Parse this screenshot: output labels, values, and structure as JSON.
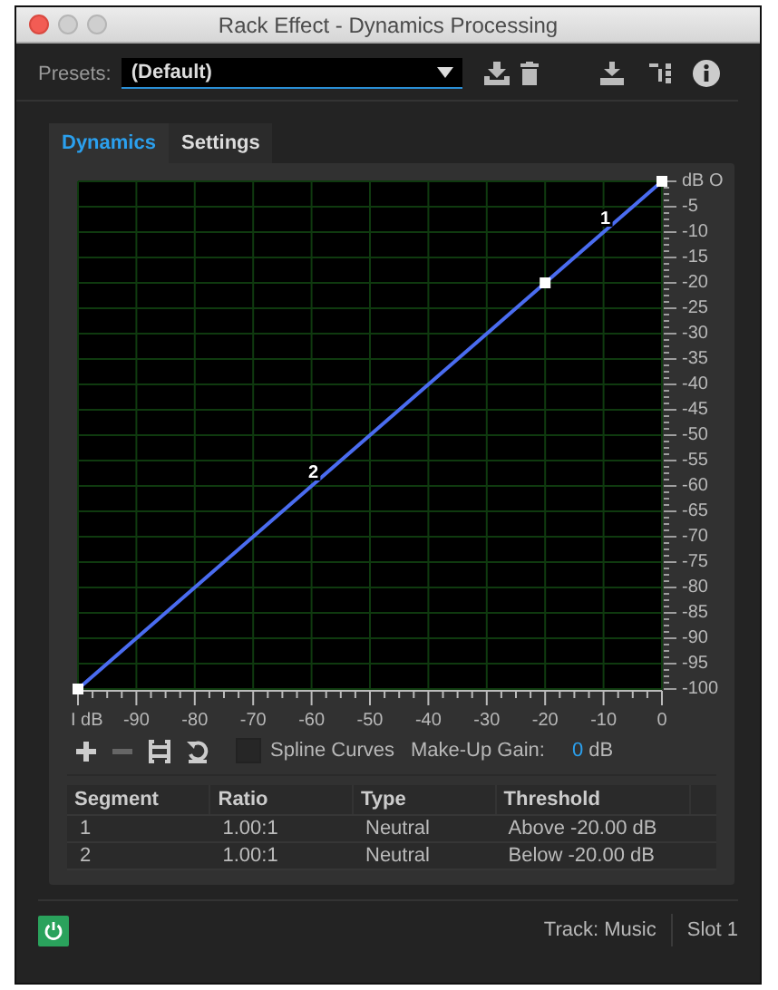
{
  "window": {
    "title": "Rack Effect - Dynamics Processing"
  },
  "presets": {
    "label": "Presets:",
    "value": "(Default)"
  },
  "tabs": [
    {
      "label": "Dynamics",
      "selected": true
    },
    {
      "label": "Settings",
      "selected": false
    }
  ],
  "graph": {
    "chart_data": {
      "type": "line",
      "x": [
        -100,
        -20,
        0
      ],
      "series": [
        {
          "color": "#4a6cf0",
          "marker": "square",
          "values": [
            -100,
            -20,
            0
          ]
        }
      ],
      "grid": true,
      "xlim": [
        -100,
        0
      ],
      "ylim": [
        -100,
        0
      ],
      "xticks": [
        {
          "value": -100,
          "label": "I dB"
        },
        -90,
        -80,
        -70,
        -60,
        -50,
        -40,
        -30,
        -20,
        -10,
        0
      ],
      "yticks": [
        {
          "value": 0,
          "label": "dB O"
        },
        -5,
        -10,
        -15,
        -20,
        -25,
        -30,
        -35,
        -40,
        -45,
        -50,
        -55,
        -60,
        -65,
        -70,
        -75,
        -80,
        -85,
        -90,
        -95,
        -100
      ],
      "annotations": [
        {
          "x": -10,
          "y": -10,
          "text": "1"
        },
        {
          "x": -60,
          "y": -60,
          "text": "2"
        }
      ]
    }
  },
  "controls": {
    "spline_curves": {
      "label": "Spline Curves",
      "checked": false
    },
    "makeup_gain": {
      "label": "Make-Up Gain:",
      "value": "0",
      "unit": "dB"
    }
  },
  "table": {
    "columns": [
      "Segment",
      "Ratio",
      "Type",
      "Threshold"
    ],
    "rows": [
      [
        "1",
        "1.00:1",
        "Neutral",
        "Above -20.00 dB"
      ],
      [
        "2",
        "1.00:1",
        "Neutral",
        "Below -20.00 dB"
      ]
    ]
  },
  "footer": {
    "power": {
      "on": true
    },
    "track": "Track: Music",
    "slot": "Slot 1"
  }
}
